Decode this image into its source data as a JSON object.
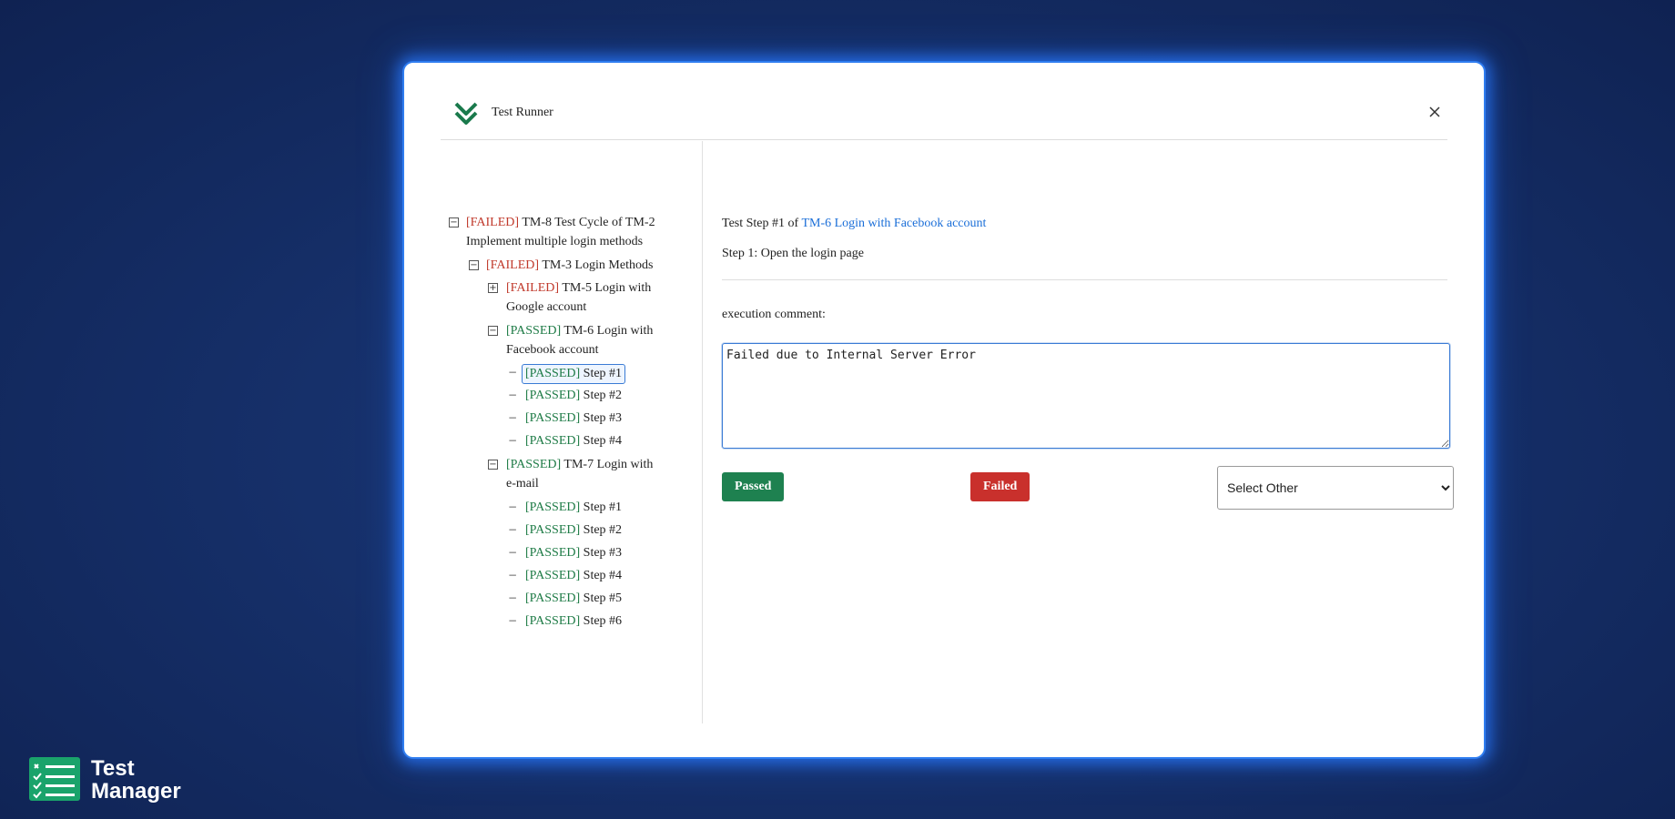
{
  "modal": {
    "title": "Test Runner",
    "close_icon": "close-icon",
    "logo_icon": "double-chevron-logo-icon",
    "accent": "#2f7df0"
  },
  "tree": {
    "root": {
      "status": "[FAILED]",
      "label": "TM-8 Test Cycle of TM-2",
      "label2": "Implement multiple login methods"
    },
    "group": {
      "status": "[FAILED]",
      "label": "TM-3 Login Methods"
    },
    "tm5": {
      "status": "[FAILED]",
      "label": "TM-5 Login with",
      "label2": "Google account"
    },
    "tm6": {
      "status": "[PASSED]",
      "label": "TM-6 Login with",
      "label2": "Facebook account",
      "steps": [
        {
          "status": "[PASSED]",
          "label": "Step #1"
        },
        {
          "status": "[PASSED]",
          "label": "Step #2"
        },
        {
          "status": "[PASSED]",
          "label": "Step #3"
        },
        {
          "status": "[PASSED]",
          "label": "Step #4"
        }
      ]
    },
    "tm7": {
      "status": "[PASSED]",
      "label": "TM-7 Login with",
      "label2": "e-mail",
      "steps": [
        {
          "status": "[PASSED]",
          "label": "Step #1"
        },
        {
          "status": "[PASSED]",
          "label": "Step #2"
        },
        {
          "status": "[PASSED]",
          "label": "Step #3"
        },
        {
          "status": "[PASSED]",
          "label": "Step #4"
        },
        {
          "status": "[PASSED]",
          "label": "Step #5"
        },
        {
          "status": "[PASSED]",
          "label": "Step #6"
        }
      ]
    },
    "collapse_symbol": "−",
    "expand_symbol": "+",
    "leaf_symbol": "−"
  },
  "main": {
    "step_header_prefix": "Test Step #1 of",
    "step_header_link": "TM-6 Login with Facebook account",
    "step_description": "Step 1: Open the login page",
    "comment_label": "execution comment:",
    "comment_value": "Failed due to Internal Server Error",
    "passed_label": "Passed",
    "failed_label": "Failed",
    "select_value": "Select Other"
  },
  "brand": {
    "line1": "Test",
    "line2": "Manager",
    "logo_icon": "checklist-logo-icon"
  },
  "colors": {
    "failed": "#c0392b",
    "passed": "#1e7b46",
    "link": "#1a6ed8",
    "passed_button": "#1e8150",
    "failed_button": "#c9302c"
  }
}
